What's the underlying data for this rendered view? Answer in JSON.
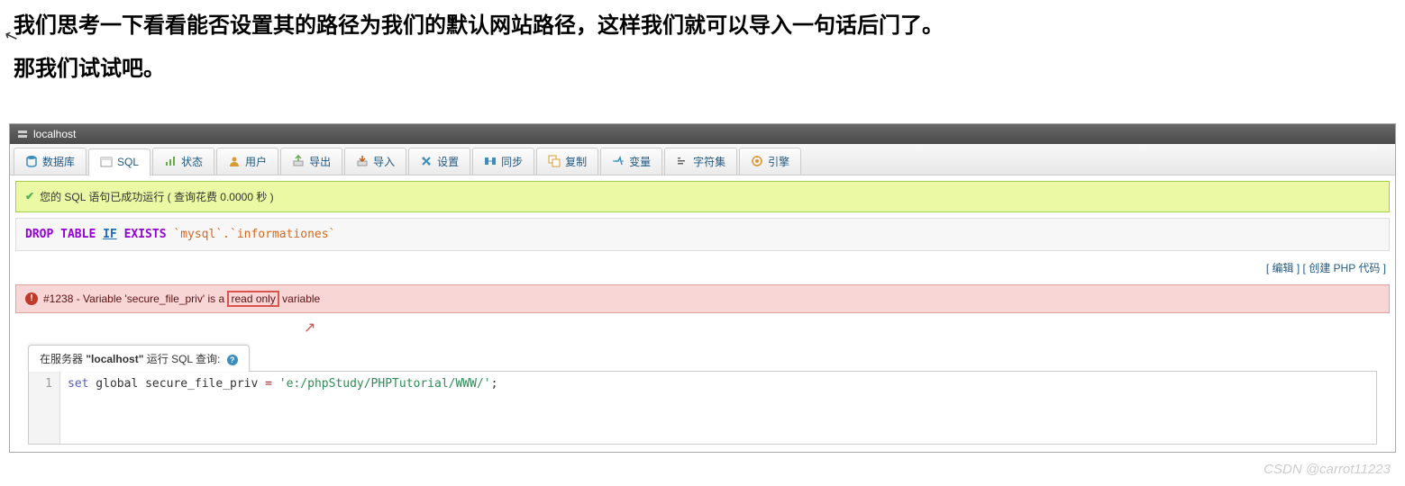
{
  "article": {
    "p1": "我们思考一下看看能否设置其的路径为我们的默认网站路径，这样我们就可以导入一句话后门了。",
    "p2": "那我们试试吧。"
  },
  "header": {
    "host": "localhost"
  },
  "tabs": [
    {
      "label": "数据库",
      "icon": "database"
    },
    {
      "label": "SQL",
      "icon": "sql",
      "active": true
    },
    {
      "label": "状态",
      "icon": "status"
    },
    {
      "label": "用户",
      "icon": "users"
    },
    {
      "label": "导出",
      "icon": "export"
    },
    {
      "label": "导入",
      "icon": "import"
    },
    {
      "label": "设置",
      "icon": "settings"
    },
    {
      "label": "同步",
      "icon": "sync"
    },
    {
      "label": "复制",
      "icon": "replication"
    },
    {
      "label": "变量",
      "icon": "variables"
    },
    {
      "label": "字符集",
      "icon": "charset"
    },
    {
      "label": "引擎",
      "icon": "engine"
    }
  ],
  "success": {
    "message": "您的 SQL 语句已成功运行 ( 查询花费 0.0000 秒 )"
  },
  "query": {
    "kw1": "DROP TABLE ",
    "kw2": "IF",
    "kw3": " EXISTS",
    "tbl": " `mysql`.`informationes`"
  },
  "links": {
    "edit": "编辑",
    "create_php": "创建 PHP 代码"
  },
  "error": {
    "prefix": "#1238 - Variable 'secure_file_priv' is a ",
    "highlight": "read only",
    "suffix": " variable"
  },
  "sql_panel": {
    "title_prefix": "在服务器 ",
    "server": "\"localhost\"",
    "title_suffix": " 运行 SQL 查询:"
  },
  "code": {
    "lineno": "1",
    "kw_set": "set",
    "rest_1": " global secure_file_priv ",
    "op": "=",
    "str": " 'e:/phpStudy/PHPTutorial/WWW/'",
    "semi": ";"
  },
  "watermark": "CSDN @carrot11223",
  "icon_colors": {
    "database": "#3b8dbd",
    "sql": "#888",
    "status": "#6aa84f",
    "users": "#d99a36",
    "export": "#6aa84f",
    "import": "#c55a11",
    "settings": "#3b8dbd",
    "sync": "#3b8dbd",
    "replication": "#d99a36",
    "variables": "#3b8dbd",
    "charset": "#666",
    "engine": "#d99a36"
  }
}
